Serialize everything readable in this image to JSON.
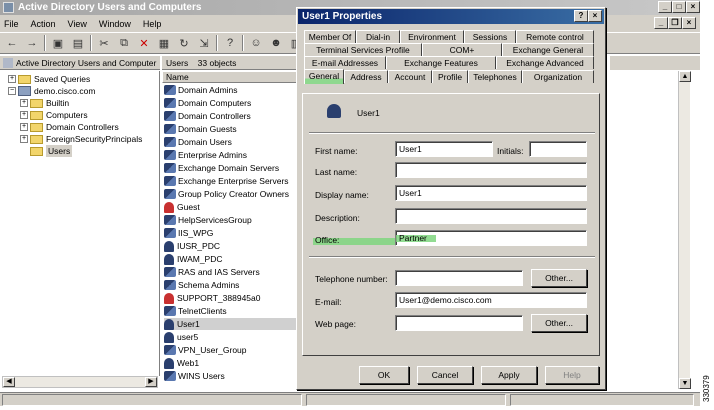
{
  "window": {
    "title": "Active Directory Users and Computers"
  },
  "menu": [
    "File",
    "Action",
    "View",
    "Window",
    "Help"
  ],
  "tree": {
    "root": "Active Directory Users and Computer",
    "items": [
      {
        "label": "Saved Queries",
        "level": 1
      },
      {
        "label": "demo.cisco.com",
        "level": 1
      },
      {
        "label": "Builtin",
        "level": 2
      },
      {
        "label": "Computers",
        "level": 2
      },
      {
        "label": "Domain Controllers",
        "level": 2
      },
      {
        "label": "ForeignSecurityPrincipals",
        "level": 2
      },
      {
        "label": "Users",
        "level": 2,
        "selected": true
      }
    ]
  },
  "list": {
    "header_name": "Users",
    "header_count": "33 objects",
    "column": "Name",
    "items": [
      {
        "label": "Domain Admins",
        "type": "group"
      },
      {
        "label": "Domain Computers",
        "type": "group"
      },
      {
        "label": "Domain Controllers",
        "type": "group"
      },
      {
        "label": "Domain Guests",
        "type": "group"
      },
      {
        "label": "Domain Users",
        "type": "group"
      },
      {
        "label": "Enterprise Admins",
        "type": "group"
      },
      {
        "label": "Exchange Domain Servers",
        "type": "group"
      },
      {
        "label": "Exchange Enterprise Servers",
        "type": "group"
      },
      {
        "label": "Group Policy Creator Owners",
        "type": "group"
      },
      {
        "label": "Guest",
        "type": "disabled"
      },
      {
        "label": "HelpServicesGroup",
        "type": "group"
      },
      {
        "label": "IIS_WPG",
        "type": "group"
      },
      {
        "label": "IUSR_PDC",
        "type": "user"
      },
      {
        "label": "IWAM_PDC",
        "type": "user"
      },
      {
        "label": "RAS and IAS Servers",
        "type": "group"
      },
      {
        "label": "Schema Admins",
        "type": "group"
      },
      {
        "label": "SUPPORT_388945a0",
        "type": "disabled"
      },
      {
        "label": "TelnetClients",
        "type": "group"
      },
      {
        "label": "User1",
        "type": "user",
        "selected": true
      },
      {
        "label": "user5",
        "type": "user"
      },
      {
        "label": "VPN_User_Group",
        "type": "group"
      },
      {
        "label": "Web1",
        "type": "user"
      },
      {
        "label": "WINS Users",
        "type": "group"
      }
    ]
  },
  "dialog": {
    "title": "User1 Properties",
    "help": "?",
    "close": "×",
    "tabs_row1": [
      "Member Of",
      "Dial-in",
      "Environment",
      "Sessions",
      "Remote control"
    ],
    "tabs_row2": [
      "Terminal Services Profile",
      "COM+",
      "Exchange General"
    ],
    "tabs_row3": [
      "E-mail Addresses",
      "Exchange Features",
      "Exchange Advanced"
    ],
    "tabs_row4": [
      "General",
      "Address",
      "Account",
      "Profile",
      "Telephones",
      "Organization"
    ],
    "user_name": "User1",
    "fields": {
      "first_name_label": "First name:",
      "first_name_value": "User1",
      "initials_label": "Initials:",
      "initials_value": "",
      "last_name_label": "Last name:",
      "last_name_value": "",
      "display_name_label": "Display name:",
      "display_name_value": "User1",
      "description_label": "Description:",
      "description_value": "",
      "office_label": "Office:",
      "office_value": "Partner",
      "telephone_label": "Telephone number:",
      "telephone_value": "",
      "email_label": "E-mail:",
      "email_value": "User1@demo.cisco.com",
      "webpage_label": "Web page:",
      "webpage_value": ""
    },
    "other_label": "Other...",
    "buttons": {
      "ok": "OK",
      "cancel": "Cancel",
      "apply": "Apply",
      "help": "Help"
    }
  },
  "figure_number": "330379"
}
